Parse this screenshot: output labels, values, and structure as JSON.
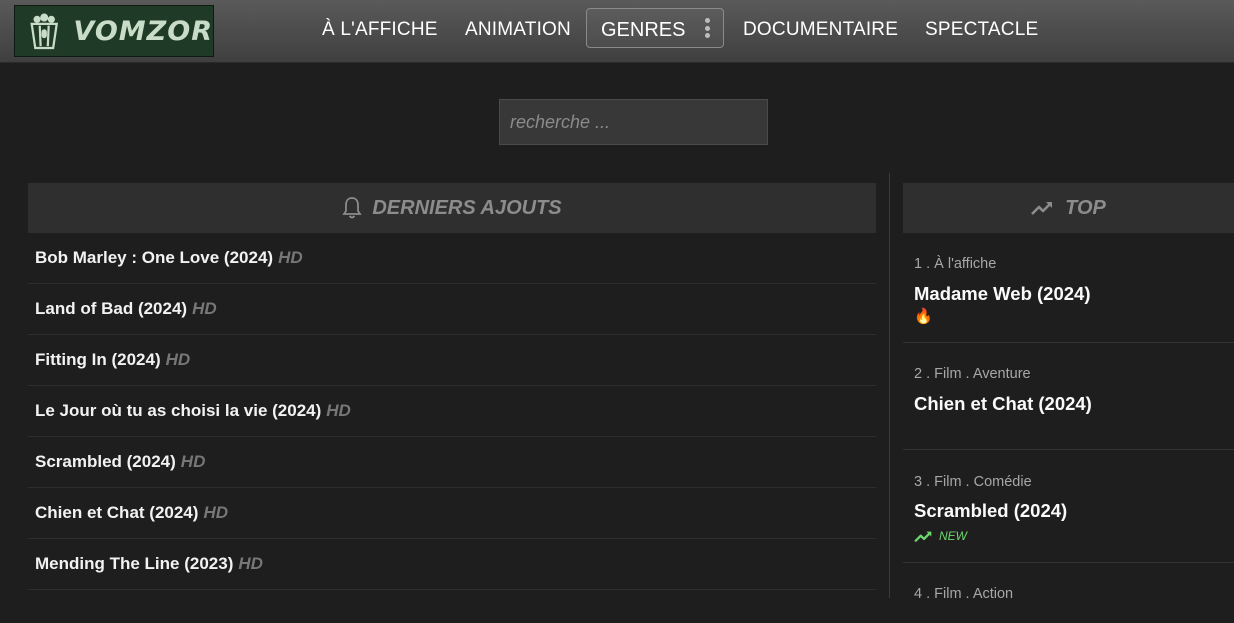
{
  "brand": {
    "name": "VOMZOR"
  },
  "nav": {
    "items": [
      "À L'AFFICHE",
      "ANIMATION",
      "GENRES",
      "DOCUMENTAIRE",
      "SPECTACLE"
    ]
  },
  "search": {
    "placeholder": "recherche ..."
  },
  "latest": {
    "title": "DERNIERS AJOUTS",
    "items": [
      {
        "title": "Bob Marley : One Love (2024)",
        "quality": "HD"
      },
      {
        "title": "Land of Bad (2024)",
        "quality": "HD"
      },
      {
        "title": "Fitting In (2024)",
        "quality": "HD"
      },
      {
        "title": "Le Jour où tu as choisi la vie (2024)",
        "quality": "HD"
      },
      {
        "title": "Scrambled (2024)",
        "quality": "HD"
      },
      {
        "title": "Chien et Chat (2024)",
        "quality": "HD"
      },
      {
        "title": "Mending The Line (2023)",
        "quality": "HD"
      }
    ]
  },
  "top": {
    "title": "TOP",
    "items": [
      {
        "category": "1 . À l'affiche",
        "title": "Madame Web (2024)",
        "badge": "🔥"
      },
      {
        "category": "2 . Film . Aventure",
        "title": "Chien et Chat (2024)",
        "badge": ""
      },
      {
        "category": "3 . Film . Comédie",
        "title": "Scrambled (2024)",
        "badge": "NEW"
      },
      {
        "category": "4 . Film . Action",
        "title": "",
        "badge": ""
      }
    ]
  },
  "colors": {
    "accent_green": "#6fd66f",
    "logo_bg": "#1f3a26"
  }
}
